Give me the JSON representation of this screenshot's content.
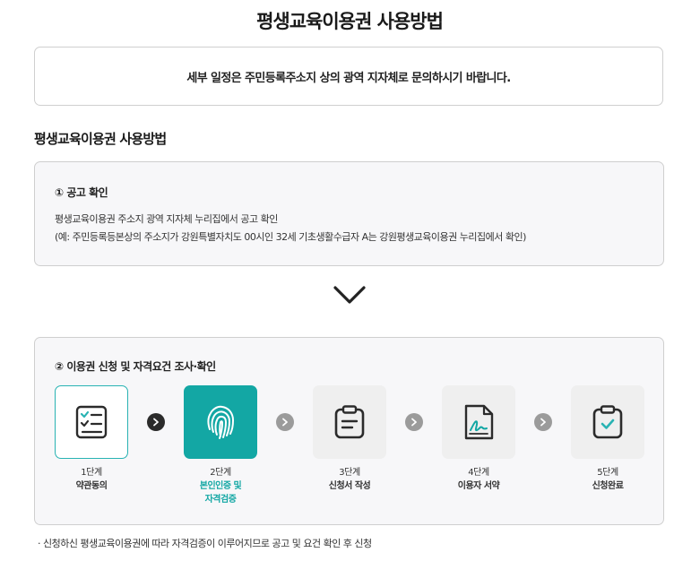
{
  "page": {
    "title": "평생교육이용권 사용방법"
  },
  "notice": {
    "text": "세부 일정은 주민등록주소지 상의 광역 지자체로 문의하시기 바랍니다."
  },
  "section": {
    "title": "평생교육이용권 사용방법"
  },
  "step1": {
    "heading": "① 공고 확인",
    "line1": "평생교육이용권 주소지 광역 지자체 누리집에서 공고 확인",
    "line2": "(예: 주민등록등본상의 주소지가 강원특별자치도 00시인 32세 기초생활수급자 A는 강원평생교육이용권 누리집에서 확인)"
  },
  "step2": {
    "heading": "② 이용권 신청 및 자격요건 조사·확인",
    "stages": [
      {
        "num": "1단계",
        "name": "약관동의",
        "icon": "checklist-icon",
        "state": "outline"
      },
      {
        "num": "2단계",
        "name_line1": "본인인증 및",
        "name_line2": "자격검증",
        "icon": "fingerprint-icon",
        "state": "active"
      },
      {
        "num": "3단계",
        "name": "신청서 작성",
        "icon": "clipboard-form-icon",
        "state": "default"
      },
      {
        "num": "4단계",
        "name": "이용자 서약",
        "icon": "signature-document-icon",
        "state": "default"
      },
      {
        "num": "5단계",
        "name": "신청완료",
        "icon": "clipboard-check-icon",
        "state": "default"
      }
    ]
  },
  "footnote": {
    "text": "신청하신 평생교육이용권에 따라 자격검증이 이루어지므로 공고 및 요건 확인 후 신청"
  },
  "colors": {
    "accent": "#13a7a4",
    "border": "#cfcfcf",
    "box_bg": "#f7f7f9"
  }
}
